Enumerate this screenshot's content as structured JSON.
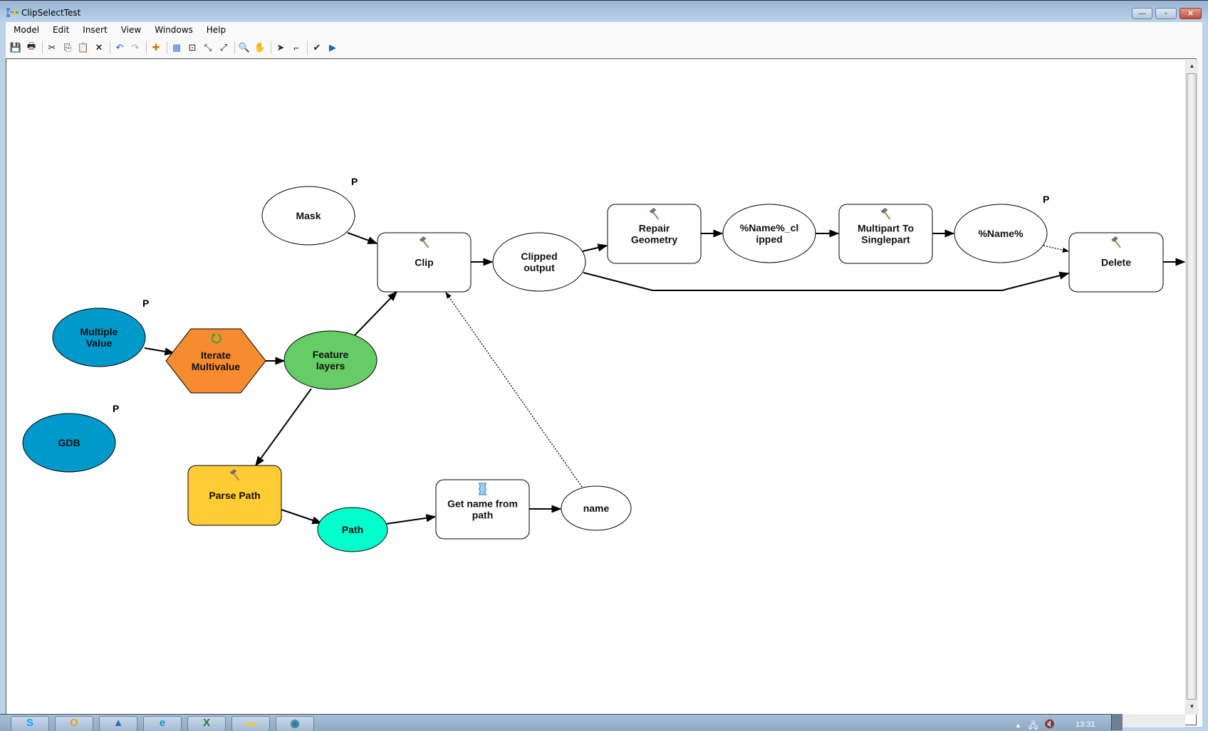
{
  "window": {
    "title": "ClipSelectTest",
    "buttons": {
      "minimize": "—",
      "maximize": "▫",
      "close": "✕"
    }
  },
  "menubar": [
    "Model",
    "Edit",
    "Insert",
    "View",
    "Windows",
    "Help"
  ],
  "toolbar": [
    {
      "name": "save-icon",
      "glyph": "💾"
    },
    {
      "name": "print-icon",
      "glyph": "🖶"
    },
    {
      "sep": true
    },
    {
      "name": "cut-icon",
      "glyph": "✂"
    },
    {
      "name": "copy-icon",
      "glyph": "⎘"
    },
    {
      "name": "paste-icon",
      "glyph": "📋"
    },
    {
      "name": "delete-icon",
      "glyph": "✕"
    },
    {
      "sep": true
    },
    {
      "name": "undo-icon",
      "glyph": "↶"
    },
    {
      "name": "redo-icon",
      "glyph": "↷"
    },
    {
      "sep": true
    },
    {
      "name": "add-data-icon",
      "glyph": "✚"
    },
    {
      "sep": true
    },
    {
      "name": "auto-layout-icon",
      "glyph": "▦"
    },
    {
      "name": "full-extent-icon",
      "glyph": "⊡"
    },
    {
      "name": "zoom-in-fixed-icon",
      "glyph": "⤡"
    },
    {
      "name": "zoom-out-fixed-icon",
      "glyph": "⤢"
    },
    {
      "sep": true
    },
    {
      "name": "zoom-in-icon",
      "glyph": "🔍"
    },
    {
      "name": "pan-icon",
      "glyph": "✋"
    },
    {
      "sep": true
    },
    {
      "name": "select-icon",
      "glyph": "➤"
    },
    {
      "name": "connect-icon",
      "glyph": "⌐"
    },
    {
      "sep": true
    },
    {
      "name": "validate-icon",
      "glyph": "✔"
    },
    {
      "name": "run-icon",
      "glyph": "▶"
    }
  ],
  "model": {
    "nodes": [
      {
        "id": "mask",
        "label": [
          "Mask"
        ],
        "shape": "ellipse",
        "fill": "#ffffff",
        "param": true
      },
      {
        "id": "clip",
        "label": [
          "Clip"
        ],
        "shape": "box",
        "fill": "#ffffff",
        "tool_icon": "hammer"
      },
      {
        "id": "clipped_output",
        "label": [
          "Clipped",
          "output"
        ],
        "shape": "ellipse",
        "fill": "#ffffff"
      },
      {
        "id": "repair_geometry",
        "label": [
          "Repair",
          "Geometry"
        ],
        "shape": "box",
        "fill": "#ffffff",
        "tool_icon": "hammer"
      },
      {
        "id": "name_clipped",
        "label": [
          "%Name%_cl",
          "ipped"
        ],
        "shape": "ellipse",
        "fill": "#ffffff"
      },
      {
        "id": "multipart",
        "label": [
          "Multipart To",
          "Singlepart"
        ],
        "shape": "box",
        "fill": "#ffffff",
        "tool_icon": "hammer"
      },
      {
        "id": "name_pct",
        "label": [
          "%Name%"
        ],
        "shape": "ellipse",
        "fill": "#ffffff",
        "param": true
      },
      {
        "id": "delete",
        "label": [
          "Delete"
        ],
        "shape": "box",
        "fill": "#ffffff",
        "tool_icon": "hammer"
      },
      {
        "id": "multiple_value",
        "label": [
          "Multiple",
          "Value"
        ],
        "shape": "ellipse",
        "fill": "#0099cc",
        "param": true
      },
      {
        "id": "iterate",
        "label": [
          "Iterate",
          "Multivalue"
        ],
        "shape": "hexagon",
        "fill": "#f68b2f",
        "tool_icon": "iterate"
      },
      {
        "id": "feature_layers",
        "label": [
          "Feature",
          "layers"
        ],
        "shape": "ellipse",
        "fill": "#66cc66"
      },
      {
        "id": "gdb",
        "label": [
          "GDB"
        ],
        "shape": "ellipse",
        "fill": "#0099cc",
        "param": true
      },
      {
        "id": "parse_path",
        "label": [
          "Parse Path"
        ],
        "shape": "box",
        "fill": "#ffcc33",
        "tool_icon": "hammer"
      },
      {
        "id": "path",
        "label": [
          "Path"
        ],
        "shape": "ellipse",
        "fill": "#00ffcc"
      },
      {
        "id": "get_name",
        "label": [
          "Get name from",
          "path"
        ],
        "shape": "box",
        "fill": "#ffffff",
        "tool_icon": "script"
      },
      {
        "id": "name",
        "label": [
          "name"
        ],
        "shape": "ellipse",
        "fill": "#ffffff"
      },
      {
        "id": "next_partial",
        "label": [],
        "shape": "ellipse",
        "fill": "#ffffff"
      }
    ],
    "connections": [
      {
        "from": "mask",
        "to": "clip",
        "style": "solid"
      },
      {
        "from": "clip",
        "to": "clipped_output",
        "style": "solid"
      },
      {
        "from": "clipped_output",
        "to": "repair_geometry",
        "style": "solid"
      },
      {
        "from": "repair_geometry",
        "to": "name_clipped",
        "style": "solid"
      },
      {
        "from": "name_clipped",
        "to": "multipart",
        "style": "solid"
      },
      {
        "from": "multipart",
        "to": "name_pct",
        "style": "solid"
      },
      {
        "from": "name_pct",
        "to": "delete",
        "style": "dotted"
      },
      {
        "from": "clipped_output",
        "to": "delete",
        "style": "solid"
      },
      {
        "from": "delete",
        "to": "next_partial",
        "style": "solid"
      },
      {
        "from": "multiple_value",
        "to": "iterate",
        "style": "solid"
      },
      {
        "from": "iterate",
        "to": "feature_layers",
        "style": "solid"
      },
      {
        "from": "feature_layers",
        "to": "clip",
        "style": "solid"
      },
      {
        "from": "feature_layers",
        "to": "parse_path",
        "style": "solid"
      },
      {
        "from": "parse_path",
        "to": "path",
        "style": "solid"
      },
      {
        "from": "path",
        "to": "get_name",
        "style": "solid"
      },
      {
        "from": "get_name",
        "to": "name",
        "style": "solid"
      },
      {
        "from": "name",
        "to": "clip",
        "style": "dotted"
      }
    ],
    "param_marker": "P"
  },
  "taskbar": {
    "apps": [
      {
        "name": "skype",
        "glyph": "S",
        "color": "#00aff0"
      },
      {
        "name": "outlook",
        "glyph": "O",
        "color": "#e8a317"
      },
      {
        "name": "arcgis",
        "glyph": "▲",
        "color": "#2f6db5"
      },
      {
        "name": "internet-explorer",
        "glyph": "e",
        "color": "#1d8fe0"
      },
      {
        "name": "excel",
        "glyph": "X",
        "color": "#1e7a3a"
      },
      {
        "name": "file-explorer",
        "glyph": "▬",
        "color": "#e6c65a"
      },
      {
        "name": "arccatalog",
        "glyph": "◉",
        "color": "#2a7c9c"
      }
    ],
    "clock": "13:31"
  }
}
